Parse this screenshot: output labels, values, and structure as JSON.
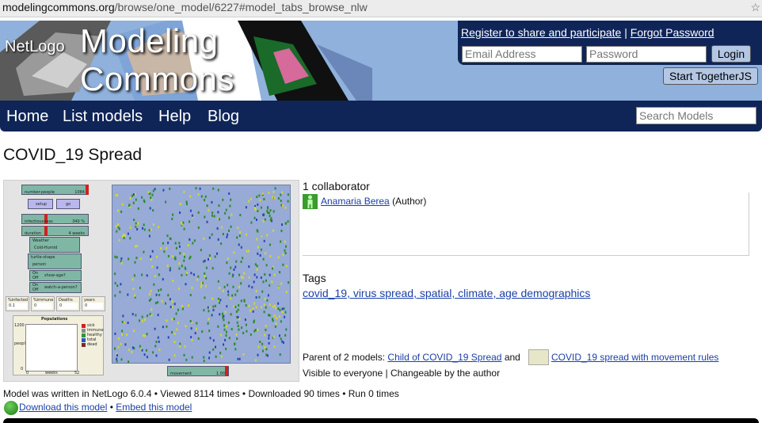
{
  "browser": {
    "url_host": "modelingcommons.org",
    "url_path": "/browse/one_model/6227#model_tabs_browse_nlw"
  },
  "header": {
    "logo_netlogo": "NetLogo",
    "logo_title": "Modeling Commons",
    "register_link": "Register to share and participate",
    "separator": "|",
    "forgot_link": "Forgot Password",
    "email_placeholder": "Email Address",
    "password_placeholder": "Password",
    "login_label": "Login",
    "together_label": "Start TogetherJS"
  },
  "nav": {
    "items": [
      "Home",
      "List models",
      "Help",
      "Blog"
    ],
    "search_placeholder": "Search Models"
  },
  "model": {
    "title": "COVID_19 Spread",
    "collaborators_heading": "1 collaborator",
    "author_name": "Anamaria Berea",
    "author_role": "(Author)",
    "tags_heading": "Tags",
    "tags": "covid_19, virus spread, spatial, climate, age demographics",
    "parent_prefix": "Parent of 2 models:",
    "child1": "Child of COVID_19 Spread",
    "and_word": "and",
    "child2": "COVID_19 spread with movement rules",
    "visibility": "Visible to everyone | Changeable by the author",
    "stats": "Model was written in NetLogo 6.0.4 • Viewed 8114 times • Downloaded 90 times • Run 0 times",
    "download_link": "Download this model",
    "bullet": "•",
    "embed_link": "Embed this model"
  },
  "preview": {
    "slider_number_people": "number-people",
    "slider_number_people_value": "1084",
    "btn_setup": "setup",
    "btn_go": "go",
    "slider_infectiousness": "infectiousness",
    "slider_infectiousness_value": "340 %",
    "slider_duration": "duration",
    "slider_duration_value": "4 weeks",
    "chooser_weather_label": "Weather",
    "chooser_weather_value": "Cold-Humid",
    "chooser_shape_label": "turtle-shape",
    "chooser_shape_value": "person",
    "switch_show_age": "show-age?",
    "switch_watch": "watch-a-person?",
    "switch_on": "On",
    "switch_off": "Off",
    "mon_infected": "%infected",
    "mon_infected_value": "0.1",
    "mon_immune": "%immune",
    "mon_immune_value": "0",
    "mon_deaths": "Deaths",
    "mon_deaths_value": "0",
    "mon_years": "years",
    "mon_years_value": "0",
    "plot_title": "Populations",
    "plot_ymax": "1200",
    "plot_ymin": "0",
    "plot_ylabel": "people",
    "plot_xlabel": "weeks",
    "plot_xmin": "0",
    "plot_xmax": "52",
    "legend": [
      "sick",
      "immune",
      "healthy",
      "total",
      "dead"
    ],
    "legend_colors": [
      "#d42020",
      "#8a8a8a",
      "#2a9a2a",
      "#2a54c8",
      "#7a2a2a"
    ],
    "slider_movement": "movement",
    "slider_movement_value": "1.00",
    "world_bg": "#97abd6",
    "agent_colors": [
      "#2b8a2b",
      "#d6d62a",
      "#2a44b8"
    ]
  }
}
